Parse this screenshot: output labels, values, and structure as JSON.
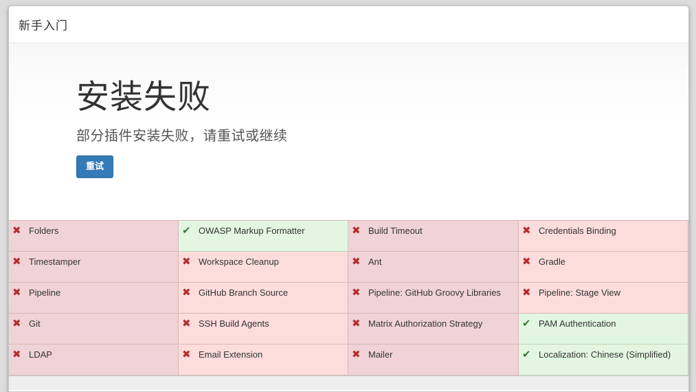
{
  "dialog": {
    "title": "新手入门"
  },
  "hero": {
    "title": "安装失败",
    "subtitle": "部分插件安装失败，请重试或继续",
    "retry_label": "重试"
  },
  "colors": {
    "failed_bg": "#fddcdc",
    "success_bg": "#e3f6e1",
    "fail_icon": "#b52b2b",
    "success_icon": "#3c7a3c",
    "button_bg": "#337ab7"
  },
  "plugins": [
    {
      "name": "Folders",
      "status": "failed"
    },
    {
      "name": "OWASP Markup Formatter",
      "status": "success"
    },
    {
      "name": "Build Timeout",
      "status": "failed"
    },
    {
      "name": "Credentials Binding",
      "status": "failed"
    },
    {
      "name": "Timestamper",
      "status": "failed"
    },
    {
      "name": "Workspace Cleanup",
      "status": "failed"
    },
    {
      "name": "Ant",
      "status": "failed"
    },
    {
      "name": "Gradle",
      "status": "failed"
    },
    {
      "name": "Pipeline",
      "status": "failed"
    },
    {
      "name": "GitHub Branch Source",
      "status": "failed"
    },
    {
      "name": "Pipeline: GitHub Groovy Libraries",
      "status": "failed"
    },
    {
      "name": "Pipeline: Stage View",
      "status": "failed"
    },
    {
      "name": "Git",
      "status": "failed"
    },
    {
      "name": "SSH Build Agents",
      "status": "failed"
    },
    {
      "name": "Matrix Authorization Strategy",
      "status": "failed"
    },
    {
      "name": "PAM Authentication",
      "status": "success"
    },
    {
      "name": "LDAP",
      "status": "failed"
    },
    {
      "name": "Email Extension",
      "status": "failed"
    },
    {
      "name": "Mailer",
      "status": "failed"
    },
    {
      "name": "Localization: Chinese (Simplified)",
      "status": "success"
    }
  ],
  "icons": {
    "failed": "close-icon",
    "success": "check-icon"
  }
}
